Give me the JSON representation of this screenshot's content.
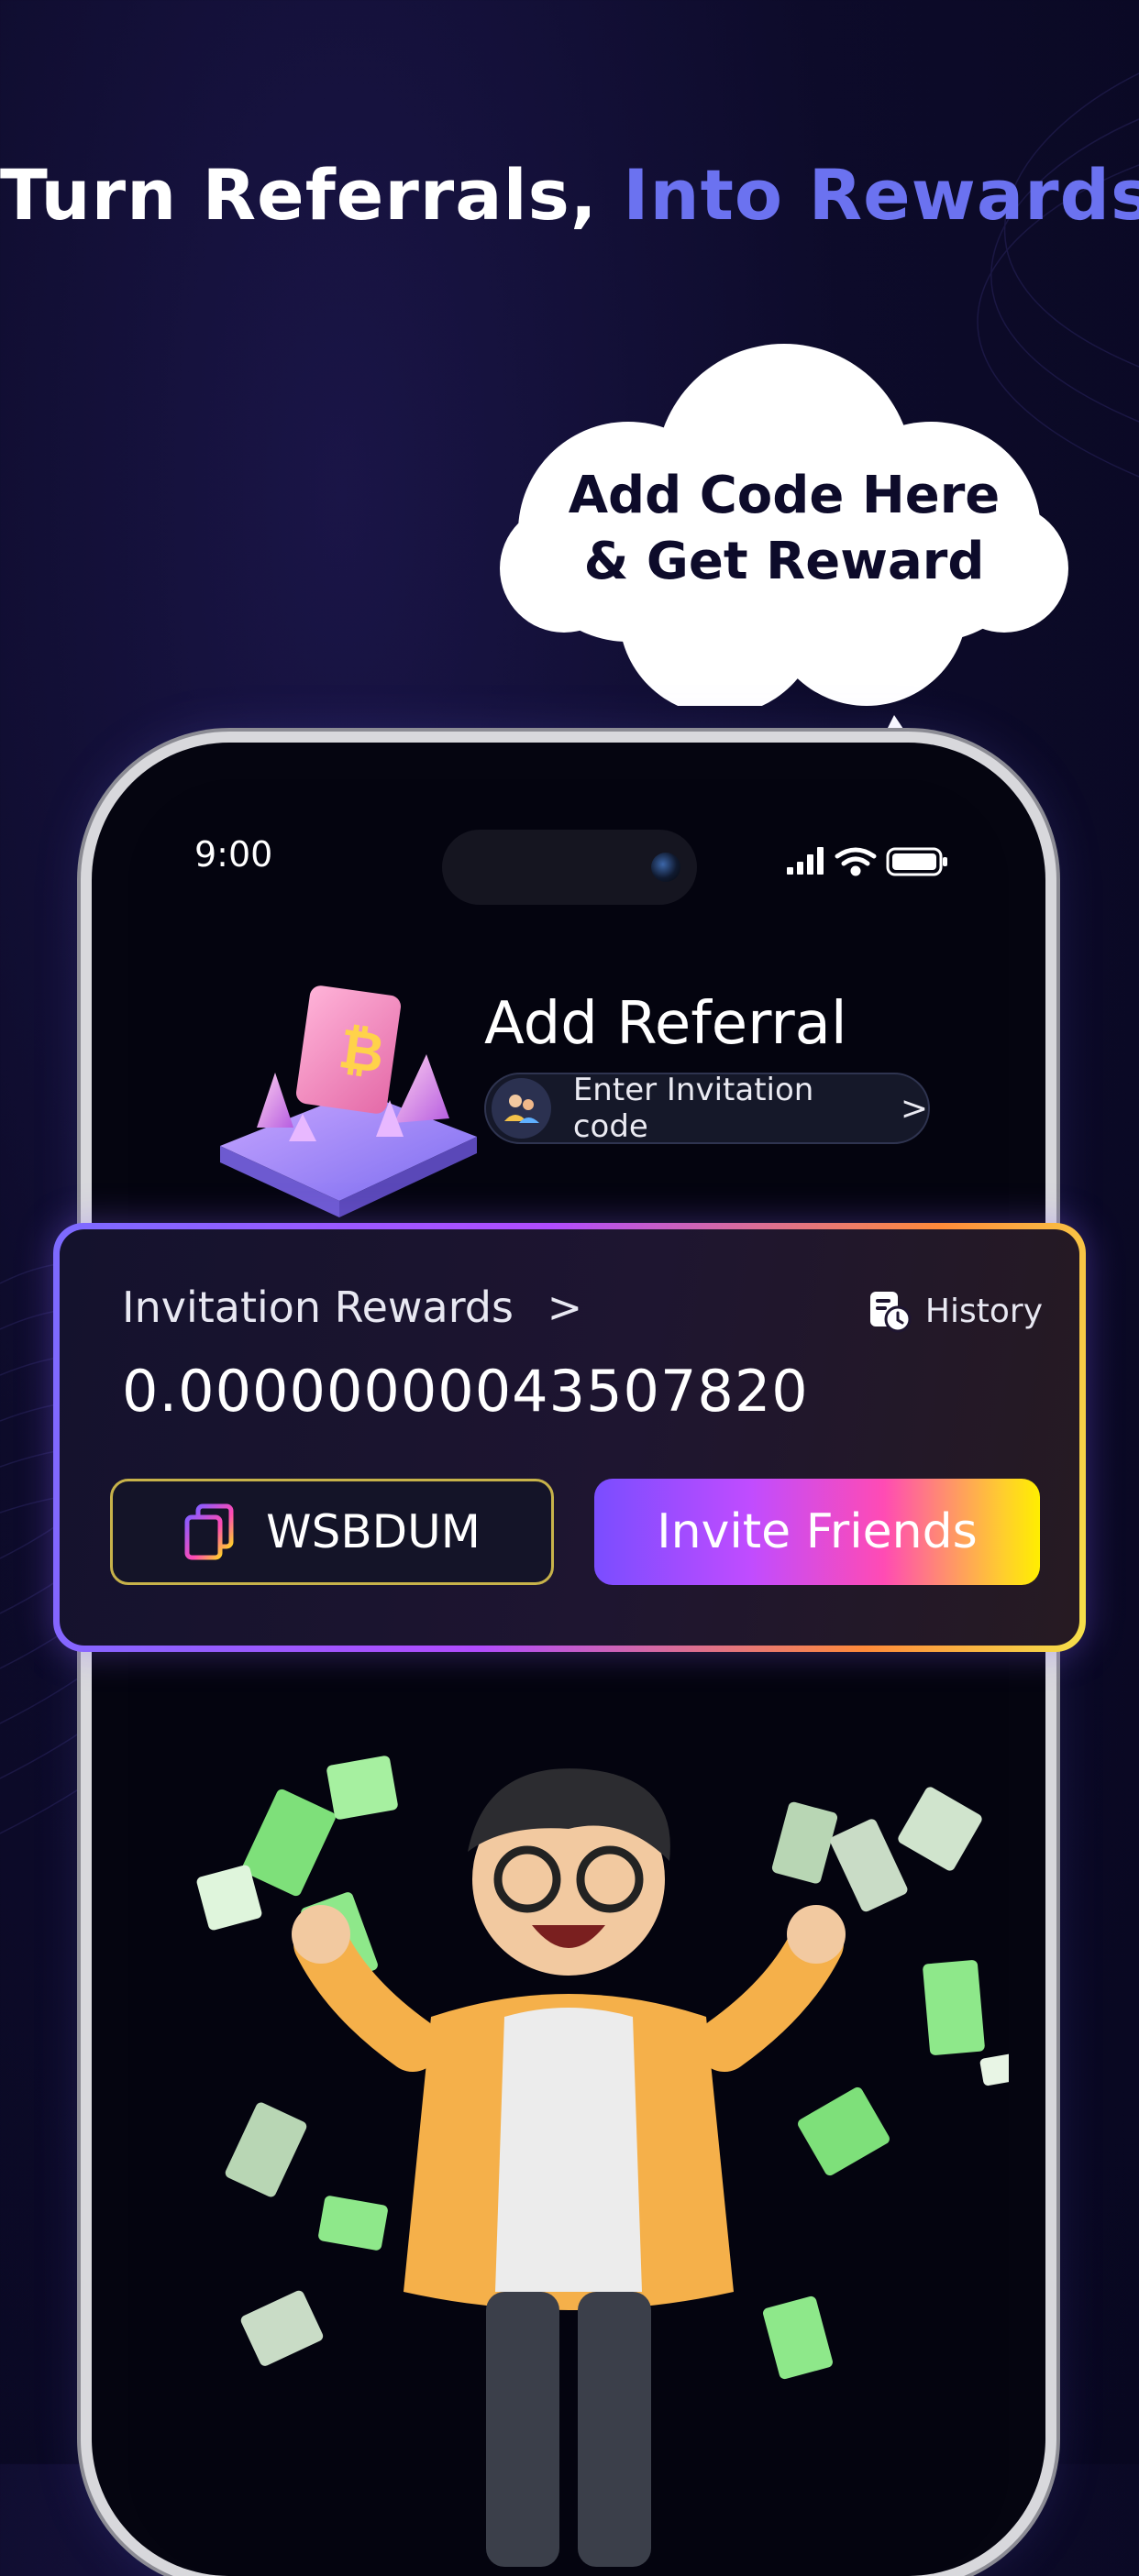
{
  "headline": {
    "part1": "Turn Referrals,",
    "part2": "Into Rewards"
  },
  "callout": {
    "line1": "Add Code Here",
    "line2": "& Get Reward"
  },
  "status_bar": {
    "time": "9:00"
  },
  "referral": {
    "title": "Add Referral",
    "input_label": "Enter Invitation code",
    "chevron": ">"
  },
  "rewards": {
    "title": "Invitation Rewards",
    "chevron": ">",
    "history_label": "History",
    "amount": "0.00000000043507820",
    "code": "WSBDUM",
    "invite_button": "Invite Friends"
  },
  "colors": {
    "background": "#0d0b2a",
    "accent_blue": "#6b72f0",
    "card_border_start": "#7c6bff",
    "card_border_end": "#f5e14a"
  },
  "icons": [
    "copy-icon",
    "history-icon",
    "avatar-icon",
    "bitcoin-crystal-illustration",
    "money-character-illustration"
  ]
}
